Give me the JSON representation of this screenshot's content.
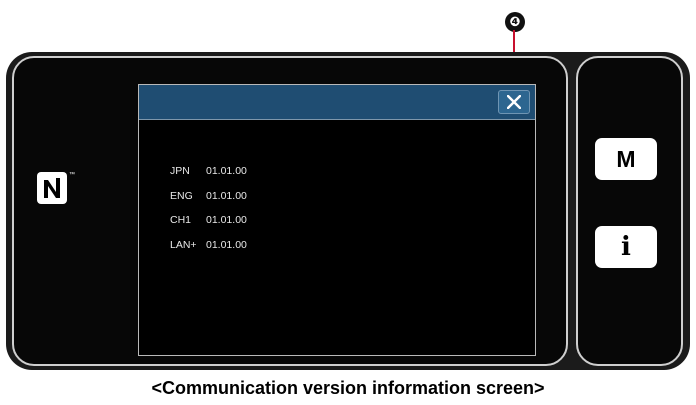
{
  "callout": {
    "number": "❹",
    "color": "#c8102e"
  },
  "nfc": {
    "icon": "nfc-n-icon",
    "trademark": "™"
  },
  "dialog": {
    "header_color": "#1f4d72",
    "close_icon": "close-x-icon",
    "items": [
      {
        "name": "JPN",
        "version": "01.01.00"
      },
      {
        "name": "ENG",
        "version": "01.01.00"
      },
      {
        "name": "CH1",
        "version": "01.01.00"
      },
      {
        "name": "LAN+",
        "version": "01.01.00"
      }
    ]
  },
  "side_buttons": {
    "menu_label": "M",
    "info_label": "i"
  },
  "caption": "<Communication version information screen>"
}
